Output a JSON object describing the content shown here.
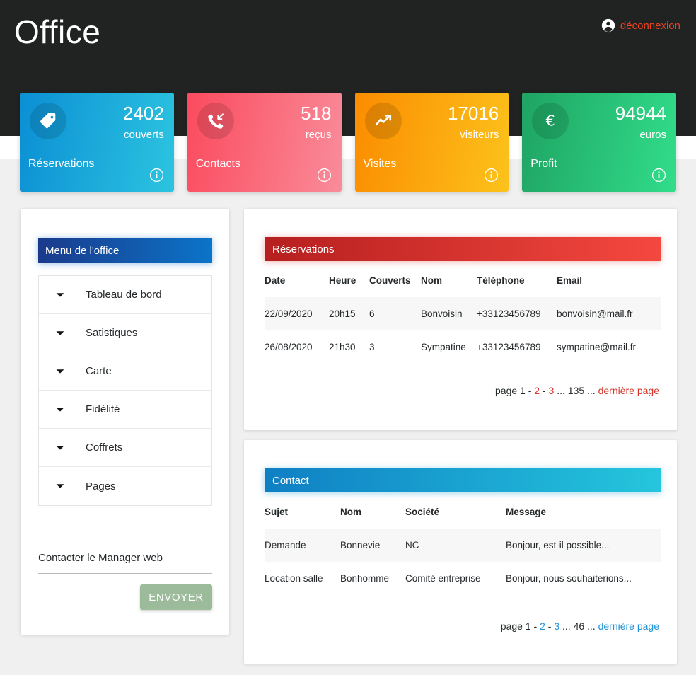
{
  "header": {
    "brand": "Office",
    "logout_label": "déconnexion",
    "logout_icon": "account-circle-icon",
    "logout_color": "#e8421f",
    "background": "#212322"
  },
  "stat_cards": [
    {
      "title": "Réservations",
      "value": "2402",
      "unit": "couverts",
      "icon": "tag-icon",
      "info_icon": "info-icon",
      "color_from": "#0b8fd4",
      "color_to": "#2cc4e0"
    },
    {
      "title": "Contacts",
      "value": "518",
      "unit": "reçus",
      "icon": "phone-incoming-icon",
      "info_icon": "info-icon",
      "color_from": "#fb4b5e",
      "color_to": "#f98c9a"
    },
    {
      "title": "Visites",
      "value": "17016",
      "unit": "visiteurs",
      "icon": "trending-line-icon",
      "info_icon": "info-icon",
      "color_from": "#fb8c00",
      "color_to": "#fcc21b"
    },
    {
      "title": "Profit",
      "value": "94944",
      "unit": "euros",
      "icon": "euro-icon",
      "info_icon": "info-icon",
      "color_from": "#1fa463",
      "color_to": "#31dd8a"
    }
  ],
  "sidebar": {
    "menu_title": "Menu de l'office",
    "menu_color_from": "#1b3a8c",
    "menu_color_to": "#0b74c8",
    "items": [
      {
        "label": "Tableau de bord",
        "icon": "chevron-down-icon"
      },
      {
        "label": "Satistiques",
        "icon": "chevron-down-icon"
      },
      {
        "label": "Carte",
        "icon": "chevron-down-icon"
      },
      {
        "label": "Fidélité",
        "icon": "chevron-down-icon"
      },
      {
        "label": "Coffrets",
        "icon": "chevron-down-icon"
      },
      {
        "label": "Pages",
        "icon": "chevron-down-icon"
      }
    ],
    "contact_form": {
      "value": "Contacter le Manager web",
      "placeholder": "Contacter le Manager web",
      "send_label": "ENVOYER",
      "send_color": "#9bbb9b"
    }
  },
  "reservations": {
    "title": "Réservations",
    "color_from": "#b61f1f",
    "color_to": "#f4483f",
    "columns": [
      "Date",
      "Heure",
      "Couverts",
      "Nom",
      "Téléphone",
      "Email"
    ],
    "rows": [
      {
        "date": "22/09/2020",
        "heure": "20h15",
        "couverts": "6",
        "nom": "Bonvoisin",
        "telephone": "+33123456789",
        "email": "bonvoisin@mail.fr"
      },
      {
        "date": "26/08/2020",
        "heure": "21h30",
        "couverts": "3",
        "nom": "Sympatine",
        "telephone": "+33123456789",
        "email": "sympatine@mail.fr"
      }
    ],
    "pager": {
      "prefix": "page 1 -",
      "page2": "2",
      "sep": "-",
      "page3": "3",
      "ellipsis_left": "...",
      "last_number": "135",
      "ellipsis_right": "...",
      "last_label": "dernière page",
      "link_color": "#d6342a"
    }
  },
  "contact": {
    "title": "Contact",
    "color_from": "#0f7fc4",
    "color_to": "#25c6dd",
    "columns": [
      "Sujet",
      "Nom",
      "Société",
      "Message"
    ],
    "rows": [
      {
        "sujet": "Demande",
        "nom": "Bonnevie",
        "societe": "NC",
        "message": "Bonjour, est-il possible..."
      },
      {
        "sujet": "Location salle",
        "nom": "Bonhomme",
        "societe": "Comité entreprise",
        "message": "Bonjour, nous souhaiterions..."
      }
    ],
    "pager": {
      "prefix": "page 1 -",
      "page2": "2",
      "sep": "-",
      "page3": "3",
      "ellipsis_left": "...",
      "last_number": "46",
      "ellipsis_right": "...",
      "last_label": "dernière page",
      "link_color": "#1f93d8"
    }
  }
}
